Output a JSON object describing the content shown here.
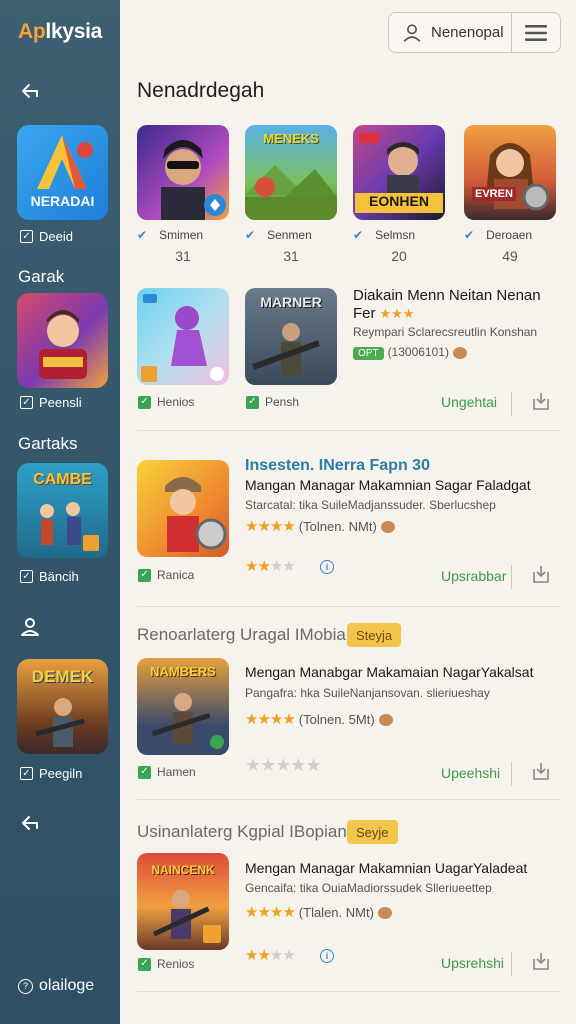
{
  "brand": {
    "prefix": "Ap",
    "rest": "lkysia"
  },
  "header": {
    "user_label": "Nenenopal",
    "title": "Nenadrdegah"
  },
  "sidebar": {
    "app_tile_text": "NERADAI",
    "items": [
      {
        "check_label": "Deeid"
      },
      {
        "section": "Garak",
        "check_label": "Peensli",
        "tile_text": ""
      },
      {
        "section": "Gartaks",
        "check_label": "Bäncih",
        "tile_text": "CAMBE"
      },
      {
        "check_label": "Peegiln",
        "tile_text": "DEMEK"
      }
    ],
    "bottom_link": "olailoge"
  },
  "featured": [
    {
      "name": "Smimen",
      "count": "31"
    },
    {
      "name": "Senmen",
      "count": "31",
      "tile_text": "MENEKS"
    },
    {
      "name": "Selmsn",
      "count": "20",
      "tile_text": "EONHEN"
    },
    {
      "name": "Deroaen",
      "count": "49",
      "tile_text": "EVREN"
    }
  ],
  "row1": {
    "tile_a_check": "Henios",
    "tile_b_check": "Pensh",
    "tile_b_text": "MARNER",
    "title": "Diakain Menn Neitan Nenan",
    "title2": "Fer",
    "subtitle": "Reympari Sclarecsreutlin Konshan",
    "badge": "OPT",
    "meta": "(13006101)",
    "action": "Ungehtai"
  },
  "row2": {
    "check": "Ranica",
    "title": "Insesten. INerra Fapn 30",
    "line2": "Mangan Managar Makamnian Sagar Faladgat",
    "line3": "Starcatal: tika SuileMadjanssuder. Sberlucshep",
    "rating_text": "(Tolnen. NMt)",
    "stars": 4,
    "stars2": 2,
    "action": "Upsrabbar"
  },
  "section2": {
    "title": "Renoarlaterg Uragal IMobian",
    "badge": "Steyja",
    "tile_text": "NAMBERS",
    "check": "Hamen",
    "title_line": "Mengan Manabgar Makamaian NagarYakalsat",
    "line3": "Pangafra: hka SuileNanjansovan. slieriueshay",
    "rating_text": "(Tolnen. 5Mt)",
    "stars": 4,
    "stars2": 0,
    "action": "Upeehshi"
  },
  "section3": {
    "title": "Usinanlaterg Kgpial IBopian",
    "badge": "Seyje",
    "tile_text": "NAINCENK",
    "check": "Renios",
    "title_line": "Mengan Managar Makamnian UagarYaladeat",
    "line3": "Gencaifa: tika OuiaMadiorssudek Slleriueettep",
    "rating_text": "(Tlalen. NMt)",
    "stars": 4,
    "stars2": 2,
    "action": "Upsrehshi"
  },
  "colors": {
    "sidebar": "#3d5f70",
    "accent_orange": "#f6a23a",
    "action_green": "#3d9a4c",
    "badge_yellow": "#f2c64a"
  }
}
